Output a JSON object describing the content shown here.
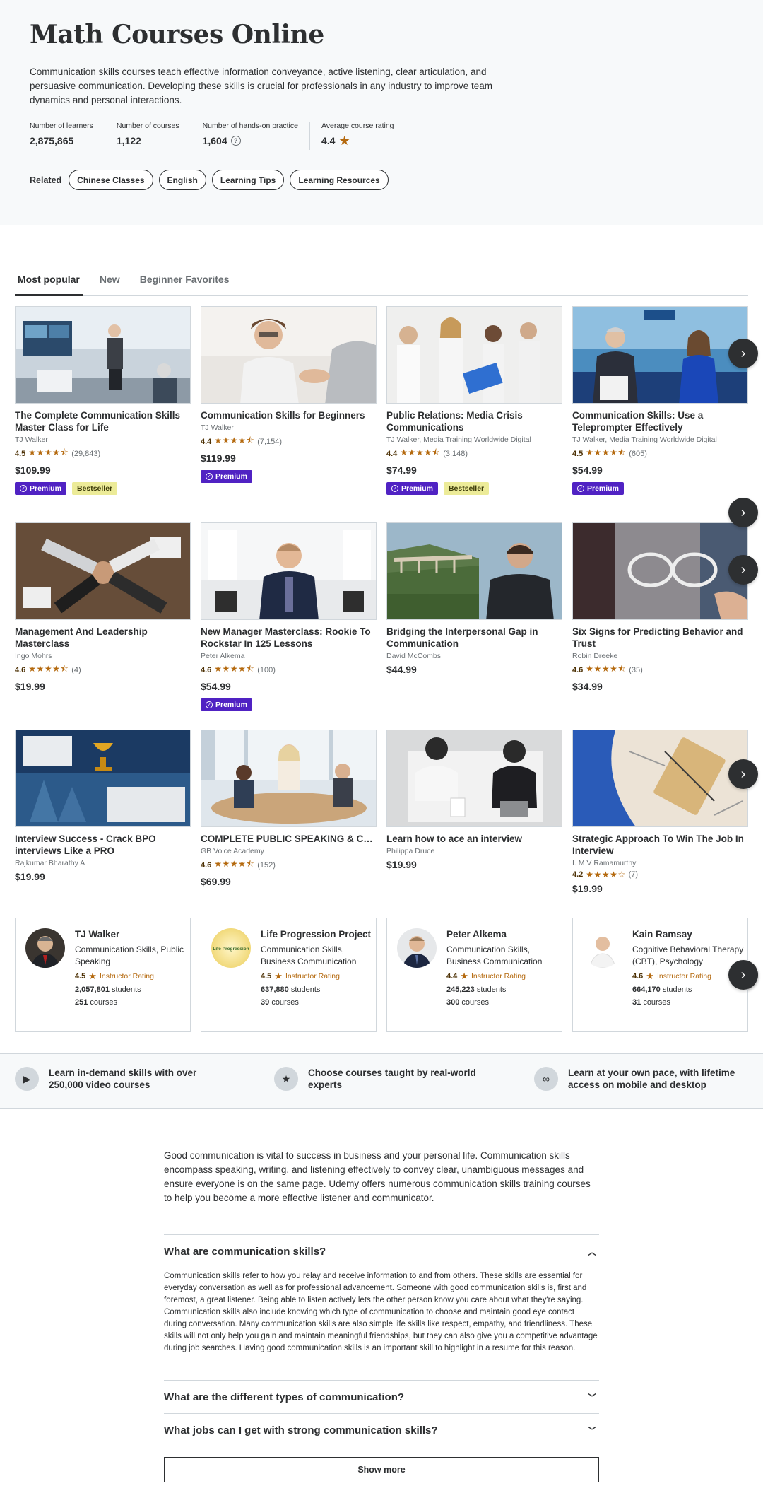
{
  "hero": {
    "title": "Math Courses Online",
    "description": "Communication skills courses teach effective information conveyance, active listening, clear articulation, and persuasive communication. Developing these skills is crucial for professionals in any industry to improve team dynamics and personal interactions.",
    "stats": [
      {
        "label": "Number of learners",
        "value": "2,875,865"
      },
      {
        "label": "Number of courses",
        "value": "1,122"
      },
      {
        "label": "Number of hands-on practice",
        "value": "1,604"
      },
      {
        "label": "Average course rating",
        "value": "4.4"
      }
    ],
    "related_label": "Related",
    "related": [
      "Chinese Classes",
      "English",
      "Learning Tips",
      "Learning Resources"
    ]
  },
  "tabs": [
    "Most popular",
    "New",
    "Beginner Favorites"
  ],
  "courses": [
    {
      "title": "The Complete Communication Skills Master Class for Life",
      "instructor": "TJ Walker",
      "rating": "4.5",
      "stars": "★★★★⯪",
      "count": "(29,843)",
      "price": "$109.99",
      "premium": "Premium",
      "bestseller": "Bestseller"
    },
    {
      "title": "Communication Skills for Beginners",
      "instructor": "TJ Walker",
      "rating": "4.4",
      "stars": "★★★★⯪",
      "count": "(7,154)",
      "price": "$119.99",
      "premium": "Premium"
    },
    {
      "title": "Public Relations: Media Crisis Communications",
      "instructor": "TJ Walker, Media Training Worldwide Digital",
      "rating": "4.4",
      "stars": "★★★★⯪",
      "count": "(3,148)",
      "price": "$74.99",
      "premium": "Premium",
      "bestseller": "Bestseller"
    },
    {
      "title": "Communication Skills: Use a Teleprompter Effectively",
      "instructor": "TJ Walker, Media Training Worldwide Digital",
      "rating": "4.5",
      "stars": "★★★★⯪",
      "count": "(605)",
      "price": "$54.99",
      "premium": "Premium"
    },
    {
      "title": "Management And Leadership Masterclass",
      "instructor": "Ingo Mohrs",
      "rating": "4.6",
      "stars": "★★★★⯪",
      "count": "(4)",
      "price": "$19.99"
    },
    {
      "title": "New Manager Masterclass: Rookie To Rockstar In 125 Lessons",
      "instructor": "Peter Alkema",
      "rating": "4.6",
      "stars": "★★★★⯪",
      "count": "(100)",
      "price": "$54.99",
      "premium": "Premium"
    },
    {
      "title": "Bridging the Interpersonal Gap in Communication",
      "instructor": "David McCombs",
      "price": "$44.99"
    },
    {
      "title": "Six Signs for Predicting Behavior and Trust",
      "instructor": "Robin Dreeke",
      "rating": "4.6",
      "stars": "★★★★⯪",
      "count": "(35)",
      "price": "$34.99"
    },
    {
      "title": "Interview Success - Crack BPO interviews Like a PRO",
      "instructor": "Rajkumar Bharathy A",
      "price": "$19.99"
    },
    {
      "title": "COMPLETE PUBLIC SPEAKING & COMMUNICATION SKILLS MASTER…",
      "instructor": "GB Voice Academy",
      "rating": "4.6",
      "stars": "★★★★⯪",
      "count": "(152)",
      "price": "$69.99"
    },
    {
      "title": "Learn how to ace an interview",
      "instructor": "Philippa Druce",
      "price": "$19.99"
    },
    {
      "title": "Strategic Approach To Win The Job In Interview",
      "instructor": "I. M V Ramamurthy",
      "rating": "4.2",
      "stars": "★★★★☆",
      "count": "(7)",
      "price": "$19.99"
    }
  ],
  "instructors": [
    {
      "name": "TJ Walker",
      "subjects": "Communication Skills, Public Speaking",
      "rating": "4.5",
      "rating_label": "Instructor Rating",
      "students": "2,057,801",
      "students_label": "students",
      "courses": "251",
      "courses_label": "courses"
    },
    {
      "name": "Life Progression Project",
      "subjects": "Communication Skills, Business Communication",
      "rating": "4.5",
      "rating_label": "Instructor Rating",
      "students": "637,880",
      "students_label": "students",
      "courses": "39",
      "courses_label": "courses",
      "logo_text": "Life Progression"
    },
    {
      "name": "Peter Alkema",
      "subjects": "Communication Skills, Business Communication",
      "rating": "4.4",
      "rating_label": "Instructor Rating",
      "students": "245,223",
      "students_label": "students",
      "courses": "300",
      "courses_label": "courses"
    },
    {
      "name": "Kain Ramsay",
      "subjects": "Cognitive Behavioral Therapy (CBT), Psychology",
      "rating": "4.6",
      "rating_label": "Instructor Rating",
      "students": "664,170",
      "students_label": "students",
      "courses": "31",
      "courses_label": "courses"
    }
  ],
  "value_props": [
    {
      "icon": "play-icon",
      "text": "Learn in-demand skills with over 250,000 video courses"
    },
    {
      "icon": "star-icon",
      "text": "Choose courses taught by real-world experts"
    },
    {
      "icon": "infinity-icon",
      "text": "Learn at your own pace, with lifetime access on mobile and desktop"
    }
  ],
  "intro": "Good communication is vital to success in business and your personal life. Communication skills encompass speaking, writing, and listening effectively to convey clear, unambiguous messages and ensure everyone is on the same page. Udemy offers numerous communication skills training courses to help you become a more effective listener and communicator.",
  "faq": [
    {
      "question": "What are communication skills?",
      "answer": "Communication skills refer to how you relay and receive information to and from others. These skills are essential for everyday conversation as well as for professional advancement. Someone with good communication skills is, first and foremost, a great listener. Being able to listen actively lets the other person know you care about what they're saying. Communication skills also include knowing which type of communication to choose and maintain good eye contact during conversation. Many communication skills are also simple life skills like respect, empathy, and friendliness. These skills will not only help you gain and maintain meaningful friendships, but they can also give you a competitive advantage during job searches. Having good communication skills is an important skill to highlight in a resume for this reason."
    },
    {
      "question": "What are the different types of communication?"
    },
    {
      "question": "What jobs can I get with strong communication skills?"
    }
  ],
  "show_more": "Show more",
  "colors": {
    "accent": "#5022c3",
    "star": "#b4690e",
    "bestseller": "#eceb98",
    "text": "#2d2f31"
  }
}
